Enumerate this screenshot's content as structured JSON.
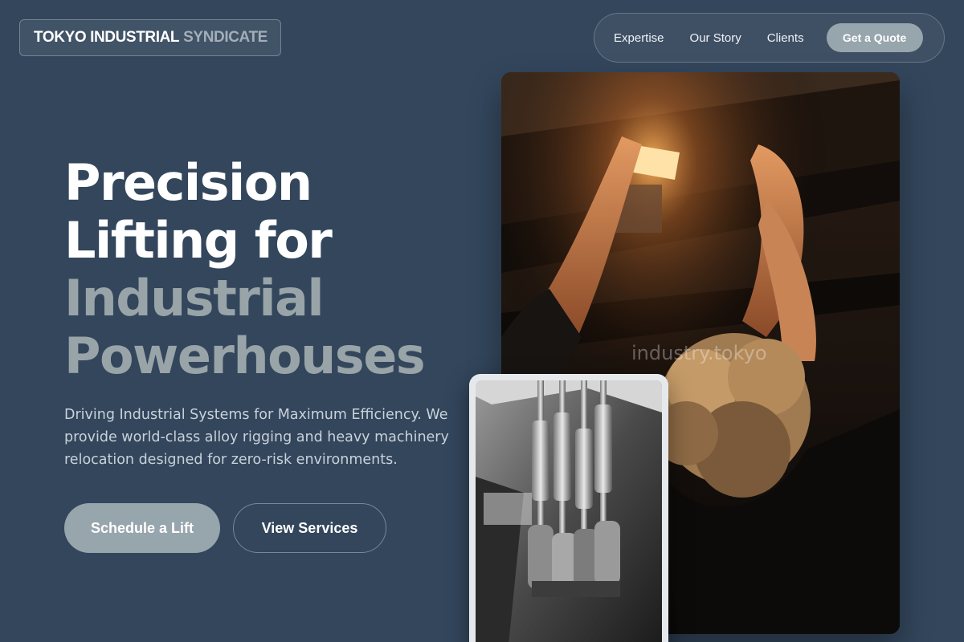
{
  "brand": {
    "name_primary": "TOKYO INDUSTRIAL",
    "name_secondary": "SYNDICATE"
  },
  "nav": {
    "links": [
      {
        "label": "Expertise"
      },
      {
        "label": "Our Story"
      },
      {
        "label": "Clients"
      }
    ],
    "cta": "Get a Quote"
  },
  "hero": {
    "headline_lines": [
      {
        "text": "Precision",
        "tone": "white"
      },
      {
        "text": "Lifting for",
        "tone": "white"
      },
      {
        "text": "Industrial",
        "tone": "grey"
      },
      {
        "text": "Powerhouses",
        "tone": "grey"
      }
    ],
    "description": "Driving Industrial Systems for Maximum Efficiency. We provide world-class alloy rigging and heavy machinery relocation designed for zero-risk environments.",
    "primary_button": "Schedule a Lift",
    "secondary_button": "View Services"
  },
  "media": {
    "main_photo_watermark": "industry.tokyo"
  },
  "colors": {
    "background": "#33465c",
    "accent": "#97a5ad",
    "headline_grey": "#98a4a8"
  }
}
